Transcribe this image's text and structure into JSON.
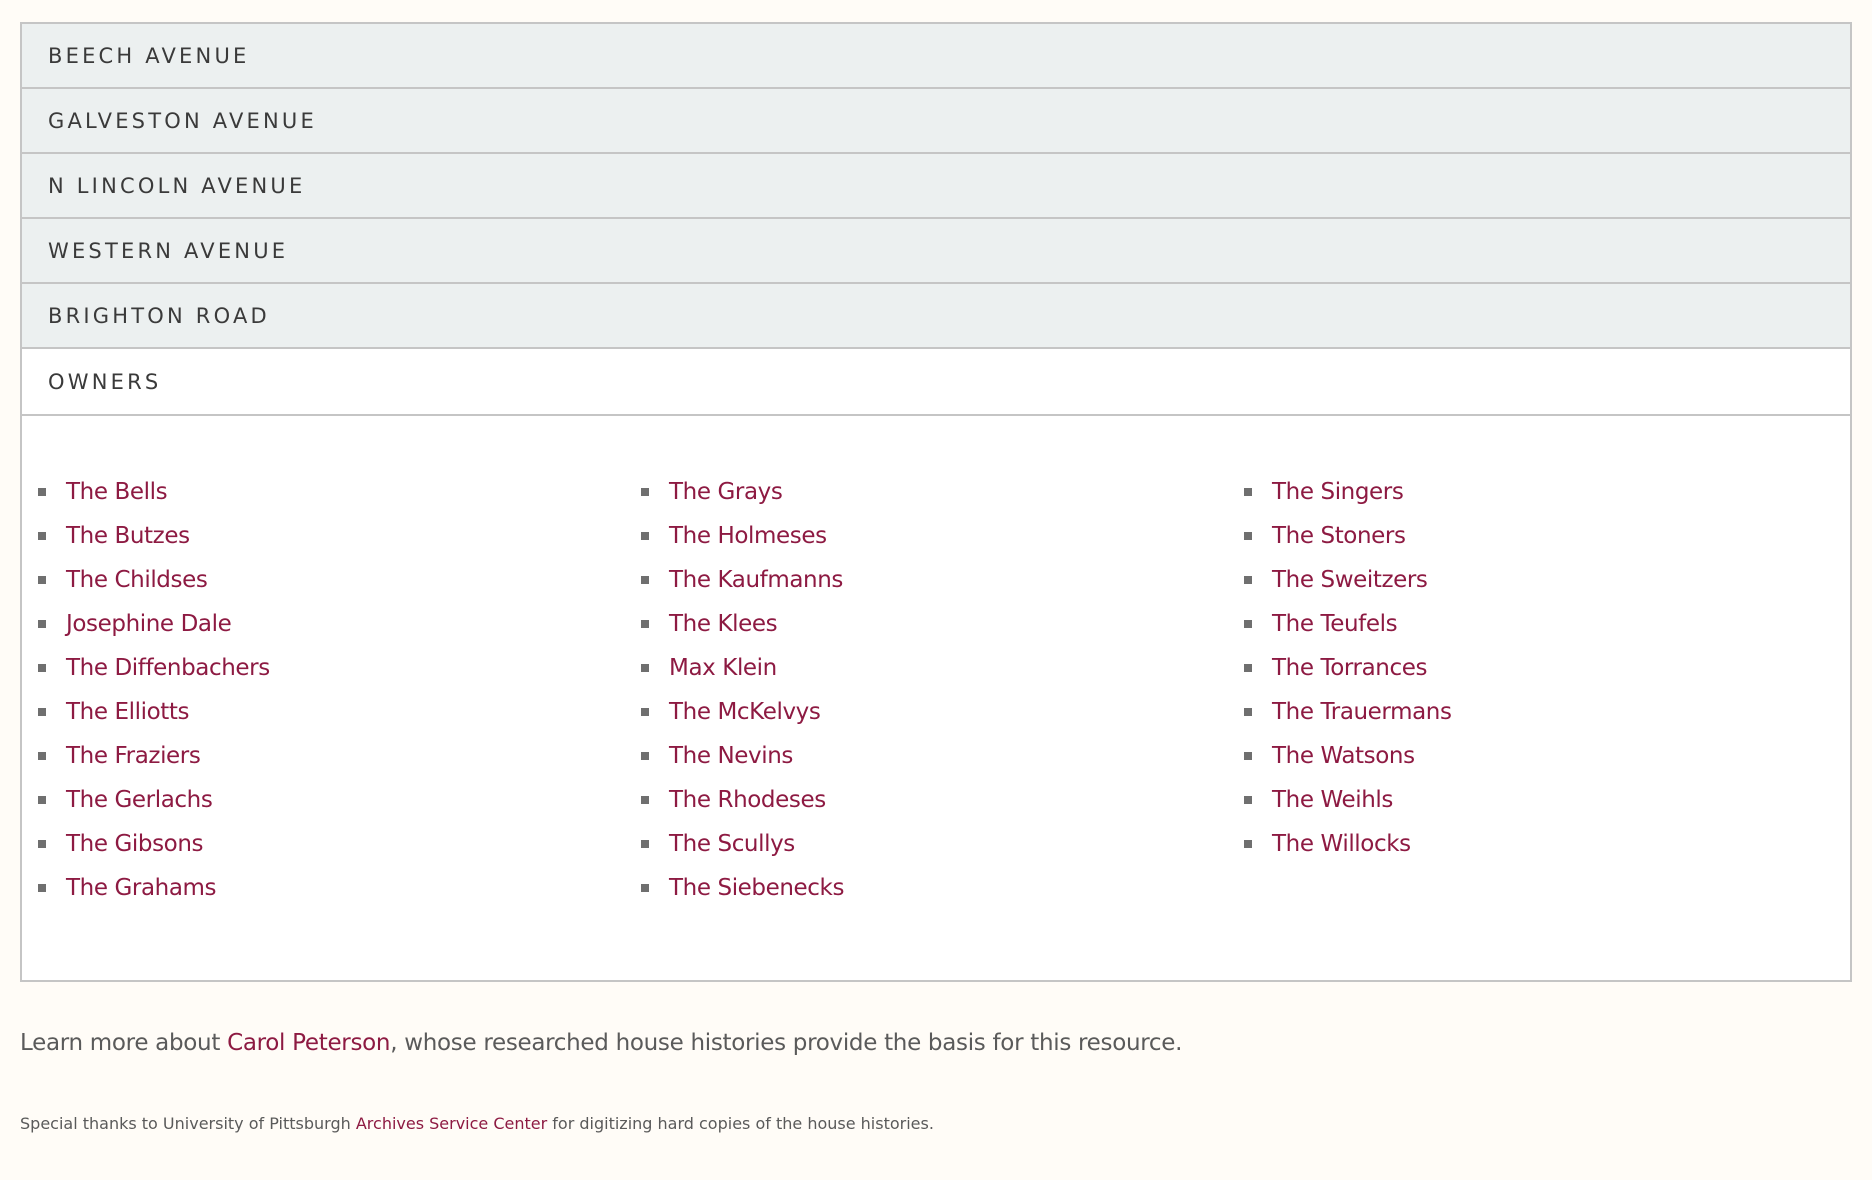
{
  "accordion": {
    "sections": [
      {
        "label": "BEECH AVENUE"
      },
      {
        "label": "GALVESTON AVENUE"
      },
      {
        "label": "N LINCOLN AVENUE"
      },
      {
        "label": "WESTERN AVENUE"
      },
      {
        "label": "BRIGHTON ROAD"
      },
      {
        "label": "OWNERS"
      }
    ]
  },
  "owners": {
    "columns": [
      [
        "The Bells",
        "The Butzes",
        "The Childses",
        "Josephine Dale",
        "The Diffenbachers",
        "The Elliotts",
        "The Fraziers",
        "The Gerlachs",
        "The Gibsons",
        "The Grahams"
      ],
      [
        "The Grays",
        "The Holmeses",
        "The Kaufmanns",
        "The Klees",
        "Max Klein",
        "The McKelvys",
        "The Nevins",
        "The Rhodeses",
        "The Scullys",
        "The Siebenecks"
      ],
      [
        "The Singers",
        "The Stoners",
        "The Sweitzers",
        "The Teufels",
        "The Torrances",
        "The Trauermans",
        "The Watsons",
        "The Weihls",
        "The Willocks"
      ]
    ]
  },
  "footer": {
    "learn_prefix": "Learn more about ",
    "learn_link": "Carol Peterson",
    "learn_suffix": ", whose researched house histories provide the basis for this resource.",
    "thanks_prefix": "Special thanks to University of Pittsburgh ",
    "thanks_link": "Archives Service Center",
    "thanks_suffix": " for digitizing hard copies of the house histories."
  },
  "colors": {
    "link": "#8d1a42",
    "header_bg": "#ecf0f0",
    "page_bg": "#fffcf7"
  }
}
